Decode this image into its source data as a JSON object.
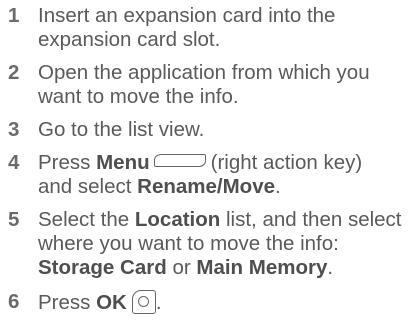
{
  "steps": [
    {
      "number": "1",
      "lines": [
        "Insert an expansion card into the",
        "expansion card slot."
      ]
    },
    {
      "number": "2",
      "lines": [
        "Open the application from which you",
        "want to move the info."
      ]
    },
    {
      "number": "3",
      "lines": [
        "Go to the list view."
      ]
    },
    {
      "number": "4",
      "press": "Press",
      "menu": "Menu",
      "paren": "(right action key)",
      "and_select": "and select",
      "rename_move": "Rename/Move",
      "period": "."
    },
    {
      "number": "5",
      "select_the": "Select the",
      "location": "Location",
      "list_then": "list, and then select",
      "line2": "where you want to move the info:",
      "storage_card": "Storage Card",
      "or": "or",
      "main_memory": "Main Memory",
      "period": "."
    },
    {
      "number": "6",
      "press": "Press",
      "ok": "OK",
      "period": "."
    }
  ],
  "icons": {
    "menu_key": "right-action-key-icon",
    "ok_key": "ok-button-icon"
  }
}
